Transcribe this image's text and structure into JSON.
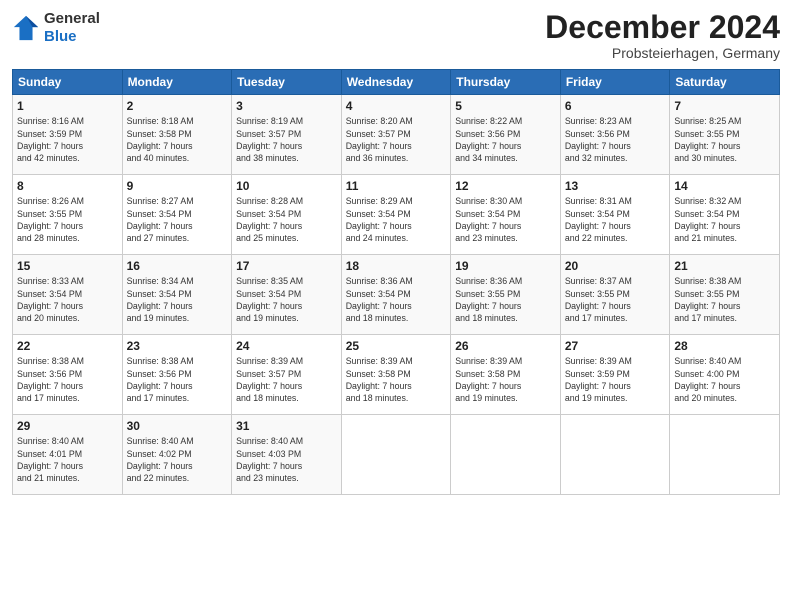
{
  "header": {
    "logo_general": "General",
    "logo_blue": "Blue",
    "month_title": "December 2024",
    "location": "Probsteierhagen, Germany"
  },
  "days_of_week": [
    "Sunday",
    "Monday",
    "Tuesday",
    "Wednesday",
    "Thursday",
    "Friday",
    "Saturday"
  ],
  "weeks": [
    [
      {
        "day": 1,
        "info": "Sunrise: 8:16 AM\nSunset: 3:59 PM\nDaylight: 7 hours\nand 42 minutes."
      },
      {
        "day": 2,
        "info": "Sunrise: 8:18 AM\nSunset: 3:58 PM\nDaylight: 7 hours\nand 40 minutes."
      },
      {
        "day": 3,
        "info": "Sunrise: 8:19 AM\nSunset: 3:57 PM\nDaylight: 7 hours\nand 38 minutes."
      },
      {
        "day": 4,
        "info": "Sunrise: 8:20 AM\nSunset: 3:57 PM\nDaylight: 7 hours\nand 36 minutes."
      },
      {
        "day": 5,
        "info": "Sunrise: 8:22 AM\nSunset: 3:56 PM\nDaylight: 7 hours\nand 34 minutes."
      },
      {
        "day": 6,
        "info": "Sunrise: 8:23 AM\nSunset: 3:56 PM\nDaylight: 7 hours\nand 32 minutes."
      },
      {
        "day": 7,
        "info": "Sunrise: 8:25 AM\nSunset: 3:55 PM\nDaylight: 7 hours\nand 30 minutes."
      }
    ],
    [
      {
        "day": 8,
        "info": "Sunrise: 8:26 AM\nSunset: 3:55 PM\nDaylight: 7 hours\nand 28 minutes."
      },
      {
        "day": 9,
        "info": "Sunrise: 8:27 AM\nSunset: 3:54 PM\nDaylight: 7 hours\nand 27 minutes."
      },
      {
        "day": 10,
        "info": "Sunrise: 8:28 AM\nSunset: 3:54 PM\nDaylight: 7 hours\nand 25 minutes."
      },
      {
        "day": 11,
        "info": "Sunrise: 8:29 AM\nSunset: 3:54 PM\nDaylight: 7 hours\nand 24 minutes."
      },
      {
        "day": 12,
        "info": "Sunrise: 8:30 AM\nSunset: 3:54 PM\nDaylight: 7 hours\nand 23 minutes."
      },
      {
        "day": 13,
        "info": "Sunrise: 8:31 AM\nSunset: 3:54 PM\nDaylight: 7 hours\nand 22 minutes."
      },
      {
        "day": 14,
        "info": "Sunrise: 8:32 AM\nSunset: 3:54 PM\nDaylight: 7 hours\nand 21 minutes."
      }
    ],
    [
      {
        "day": 15,
        "info": "Sunrise: 8:33 AM\nSunset: 3:54 PM\nDaylight: 7 hours\nand 20 minutes."
      },
      {
        "day": 16,
        "info": "Sunrise: 8:34 AM\nSunset: 3:54 PM\nDaylight: 7 hours\nand 19 minutes."
      },
      {
        "day": 17,
        "info": "Sunrise: 8:35 AM\nSunset: 3:54 PM\nDaylight: 7 hours\nand 19 minutes."
      },
      {
        "day": 18,
        "info": "Sunrise: 8:36 AM\nSunset: 3:54 PM\nDaylight: 7 hours\nand 18 minutes."
      },
      {
        "day": 19,
        "info": "Sunrise: 8:36 AM\nSunset: 3:55 PM\nDaylight: 7 hours\nand 18 minutes."
      },
      {
        "day": 20,
        "info": "Sunrise: 8:37 AM\nSunset: 3:55 PM\nDaylight: 7 hours\nand 17 minutes."
      },
      {
        "day": 21,
        "info": "Sunrise: 8:38 AM\nSunset: 3:55 PM\nDaylight: 7 hours\nand 17 minutes."
      }
    ],
    [
      {
        "day": 22,
        "info": "Sunrise: 8:38 AM\nSunset: 3:56 PM\nDaylight: 7 hours\nand 17 minutes."
      },
      {
        "day": 23,
        "info": "Sunrise: 8:38 AM\nSunset: 3:56 PM\nDaylight: 7 hours\nand 17 minutes."
      },
      {
        "day": 24,
        "info": "Sunrise: 8:39 AM\nSunset: 3:57 PM\nDaylight: 7 hours\nand 18 minutes."
      },
      {
        "day": 25,
        "info": "Sunrise: 8:39 AM\nSunset: 3:58 PM\nDaylight: 7 hours\nand 18 minutes."
      },
      {
        "day": 26,
        "info": "Sunrise: 8:39 AM\nSunset: 3:58 PM\nDaylight: 7 hours\nand 19 minutes."
      },
      {
        "day": 27,
        "info": "Sunrise: 8:39 AM\nSunset: 3:59 PM\nDaylight: 7 hours\nand 19 minutes."
      },
      {
        "day": 28,
        "info": "Sunrise: 8:40 AM\nSunset: 4:00 PM\nDaylight: 7 hours\nand 20 minutes."
      }
    ],
    [
      {
        "day": 29,
        "info": "Sunrise: 8:40 AM\nSunset: 4:01 PM\nDaylight: 7 hours\nand 21 minutes."
      },
      {
        "day": 30,
        "info": "Sunrise: 8:40 AM\nSunset: 4:02 PM\nDaylight: 7 hours\nand 22 minutes."
      },
      {
        "day": 31,
        "info": "Sunrise: 8:40 AM\nSunset: 4:03 PM\nDaylight: 7 hours\nand 23 minutes."
      },
      null,
      null,
      null,
      null
    ]
  ]
}
